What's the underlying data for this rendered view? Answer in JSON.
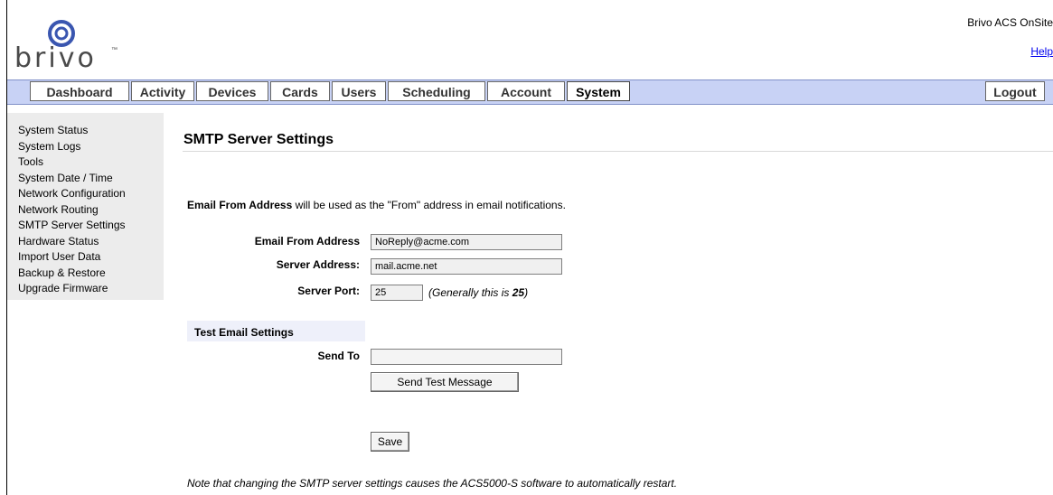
{
  "header": {
    "logo_text": "brivo",
    "logo_tm": "™",
    "app_name": "Brivo ACS OnSite",
    "help_label": "Help"
  },
  "nav": {
    "tabs": [
      "Dashboard",
      "Activity",
      "Devices",
      "Cards",
      "Users",
      "Scheduling",
      "Account",
      "System"
    ],
    "active": "System",
    "logout_label": "Logout"
  },
  "sidebar": {
    "items": [
      "System Status",
      "System Logs",
      "Tools",
      "System Date / Time",
      "Network Configuration",
      "Network Routing",
      "SMTP Server Settings",
      "Hardware Status",
      "Import User Data",
      "Backup & Restore",
      "Upgrade Firmware"
    ]
  },
  "main": {
    "title": "SMTP Server Settings",
    "intro_bold": "Email From Address",
    "intro_rest": " will be used as the \"From\" address in email notifications.",
    "email_from_label": "Email From Address",
    "email_from_value": "NoReply@acme.com",
    "server_address_label": "Server Address:",
    "server_address_value": "mail.acme.net",
    "server_port_label": "Server Port:",
    "server_port_value": "25",
    "port_hint_prefix": "(Generally this is ",
    "port_hint_value": "25",
    "port_hint_suffix": ")",
    "test_title": "Test Email Settings",
    "send_to_label": "Send To",
    "send_to_value": "",
    "send_test_label": "Send Test Message",
    "save_label": "Save",
    "note": "Note that changing the SMTP server settings causes the ACS5000-S software to automatically restart."
  },
  "colors": {
    "navbar_bg": "#c8d2f5",
    "sidebar_bg": "#ececec",
    "link": "#0000ee",
    "logo_ring": "#3a56b0"
  }
}
